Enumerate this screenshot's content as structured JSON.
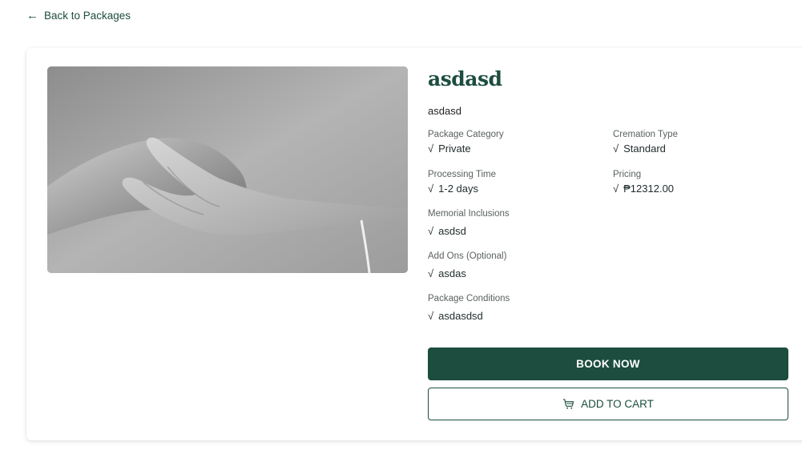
{
  "nav": {
    "back_label": "Back to Packages",
    "back_icon": "arrow-left-icon"
  },
  "package": {
    "name": "asdasd",
    "description": "asdasd",
    "image_icon": "hand-holding-paw-photo",
    "fields": {
      "category": {
        "label": "Package Category",
        "value": "Private"
      },
      "cremation": {
        "label": "Cremation Type",
        "value": "Standard"
      },
      "processing": {
        "label": "Processing Time",
        "value": "1-2 days"
      },
      "pricing": {
        "label": "Pricing",
        "value": "₱12312.00"
      },
      "memorial": {
        "label": "Memorial Inclusions",
        "value": "asdsd"
      },
      "addons": {
        "label": "Add Ons (Optional)",
        "value": "asdas"
      },
      "conditions": {
        "label": "Package Conditions",
        "value": "asdasdsd"
      }
    },
    "check_glyph": "√"
  },
  "actions": {
    "book_label": "BOOK NOW",
    "cart_label": "ADD TO CART",
    "cart_icon": "shopping-cart-icon"
  },
  "colors": {
    "brand": "#1c4d3e",
    "text": "#1f2a2a",
    "muted": "#5a6160"
  }
}
